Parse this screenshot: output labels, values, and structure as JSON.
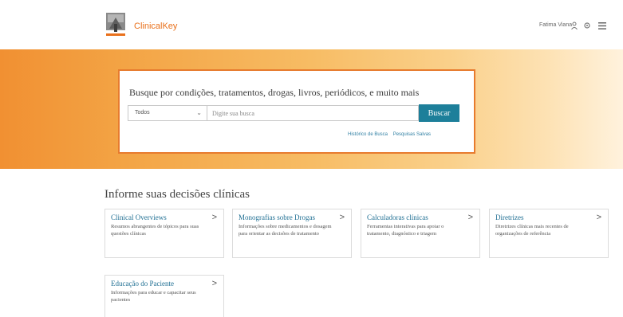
{
  "header": {
    "brand": "ClinicalKey",
    "user_name": "Fatima Viana",
    "icons": [
      "elsevier-logo-icon",
      "user-icon",
      "settings-icon",
      "menu-icon"
    ]
  },
  "search": {
    "title": "Busque por condições, tratamentos, drogas, livros, periódicos, e muito mais",
    "select_value": "Todos",
    "input_placeholder": "Digite sua busca",
    "input_value": "",
    "button_label": "Buscar",
    "links": [
      "Histórico de Busca",
      "Pesquisas Salvas"
    ]
  },
  "section": {
    "title": "Informe suas decisões clínicas"
  },
  "cards": [
    {
      "title": "Clinical Overviews",
      "desc": "Resumos abrangentes de tópicos para suas questões clínicas"
    },
    {
      "title": "Monografias sobre Drogas",
      "desc": "Informações sobre medicamentos e dosagem para orientar as decisões de tratamento"
    },
    {
      "title": "Calculadoras clínicas",
      "desc": "Ferramentas interativas para apoiar o tratamento, diagnóstico e triagem"
    },
    {
      "title": "Diretrizes",
      "desc": "Diretrizes clínicas mais recentes de organizações de referência"
    },
    {
      "title": "Educação do Paciente",
      "desc": "Informações para educar e capacitar seus pacientes"
    }
  ],
  "colors": {
    "accent_orange": "#e77b2e",
    "button_teal": "#1d7f9a",
    "link_blue": "#1f6f93"
  }
}
